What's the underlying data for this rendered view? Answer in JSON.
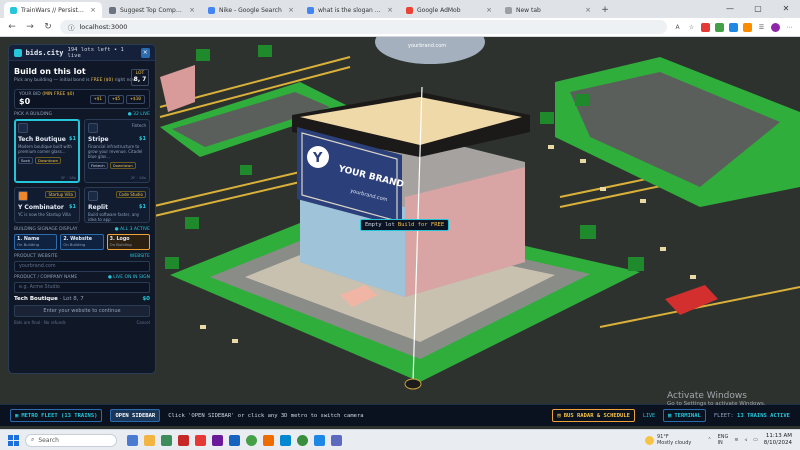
{
  "browser": {
    "tabs": [
      {
        "title": "TrainWars // Persistent 3D World",
        "active": true,
        "color": "#26c6da"
      },
      {
        "title": "Suggest Top Companies",
        "active": false,
        "color": "#6b7280"
      },
      {
        "title": "Nike - Google Search",
        "active": false,
        "color": "#4285f4"
      },
      {
        "title": "what is the slogan of Nike - Google",
        "active": false,
        "color": "#4285f4"
      },
      {
        "title": "Google AdMob",
        "active": false,
        "color": "#ea4335"
      },
      {
        "title": "New tab",
        "active": false,
        "color": "#9aa0a6"
      }
    ],
    "url": "localhost:3000"
  },
  "panel": {
    "brand": "bids.city",
    "lots_left": "194 lots left • 1 live",
    "close": "×",
    "title": "Build on this lot",
    "subtitle_pre": "Pick any building — initial bond is",
    "subtitle_highlight": "FREE ($0)",
    "subtitle_post": "right now",
    "lot_label": "LOT",
    "lot_value": "8, 7",
    "bid_label": "YOUR BID",
    "bid_highlight": "(MIN FREE $0)",
    "bid_value": "$0",
    "bid_chips": [
      "+$1",
      "+$5",
      "+$10"
    ],
    "section_label": "PICK A BUILDING",
    "section_right": "● 32 LIVE",
    "cards": [
      {
        "title": "Tech Boutique",
        "price": "$1",
        "tag": "",
        "desc": "Modern boutique built with premium corner glass...",
        "chips": [
          "Sock",
          "Downtown"
        ],
        "foot": "2F · 18x",
        "selected": true
      },
      {
        "title": "Stripe",
        "price": "$1",
        "tag": "Fintech",
        "desc": "Financial infrastructure to grow your revenue. Citadel blue glas...",
        "chips": [
          "Fintech",
          "Downtown"
        ],
        "foot": "2F · 18x",
        "selected": false
      },
      {
        "title": "Y Combinator",
        "price": "$1",
        "tag": "Startup Villa",
        "desc": "YC is now the Startup Villa",
        "chips": [],
        "foot": "",
        "selected": false
      },
      {
        "title": "Replit",
        "price": "$1",
        "tag": "Code Studio",
        "desc": "Build software faster, any idea to app",
        "chips": [],
        "foot": "",
        "selected": false
      }
    ],
    "signage_label": "BUILDING SIGNAGE DISPLAY",
    "signage_right": "● ALL 3 ACTIVE",
    "signage": [
      {
        "title": "1. Name",
        "sub": "On Building",
        "active": false
      },
      {
        "title": "2. Website",
        "sub": "On Building",
        "active": false
      },
      {
        "title": "3. Logo",
        "sub": "On Building",
        "active": true
      }
    ],
    "website_label": "PRODUCT WEBSITE",
    "website_right": "WEBSITE",
    "website_placeholder": "yourbrand.com",
    "company_label": "PRODUCT / COMPANY NAME",
    "company_right": "● LIVE ON IN SIGN",
    "company_placeholder": "e.g. Acme Studio",
    "summary_name": "Tech Boutique",
    "summary_lot": "· Lot 8, 7",
    "summary_price": "$0",
    "cta": "Enter your website to continue",
    "foot_left": "Bids are final · No refunds",
    "foot_right": "Cancel"
  },
  "scene": {
    "sign_name": "YOUR BRAND",
    "sign_url": "yourbrand.com",
    "sign_logo": "Y",
    "top_sign_url": "yourbrand.com",
    "tooltip_pre": "Empty lot",
    "tooltip_highlight": "Build for FREE"
  },
  "bottombar": {
    "fleet_button": "METRO FLEET (13 TRAINS)",
    "open_sidebar": "OPEN SIDEBAR",
    "hint": "Click 'OPEN SIDEBAR' or click any 3D metro to switch camera",
    "radar_button": "BUS RADAR & SCHEDULE",
    "live": "LIVE",
    "terminal": "TERMINAL",
    "fleet_prefix": "FLEET:",
    "fleet_status": "13 TRAINS ACTIVE"
  },
  "activate": {
    "title": "Activate Windows",
    "sub": "Go to Settings to activate Windows."
  },
  "taskbar": {
    "search": "Search",
    "temp": "91°F",
    "weather": "Mostly cloudy",
    "lang1": "ENG",
    "lang2": "IN",
    "time": "11:13 AM",
    "date": "8/10/2024"
  },
  "colors": {
    "accent": "#26c6da",
    "gold": "#f6c344",
    "panel_bg": "#101828",
    "grass": "#2fae3c"
  }
}
